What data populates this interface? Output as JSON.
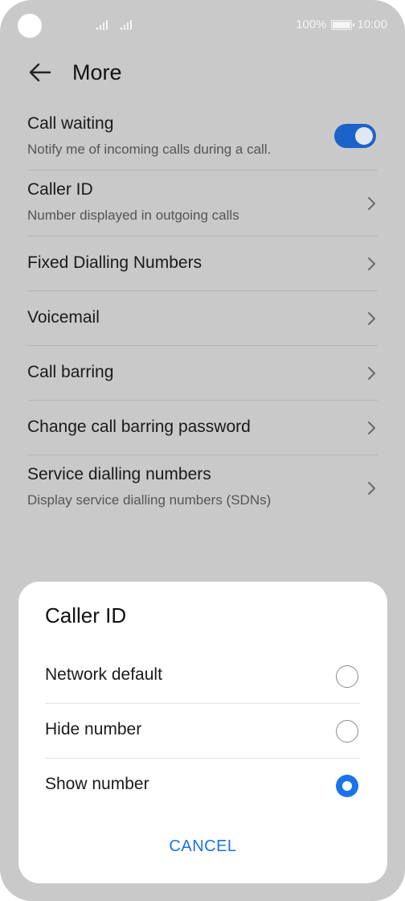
{
  "status_bar": {
    "battery_text": "100%",
    "time": "10:00"
  },
  "header": {
    "title": "More"
  },
  "settings": [
    {
      "label": "Call waiting",
      "sub": "Notify me of incoming calls during a call.",
      "control": "toggle",
      "toggle_on": true
    },
    {
      "label": "Caller ID",
      "sub": "Number displayed in outgoing calls",
      "control": "chevron"
    },
    {
      "label": "Fixed Dialling Numbers",
      "sub": "",
      "control": "chevron"
    },
    {
      "label": "Voicemail",
      "sub": "",
      "control": "chevron"
    },
    {
      "label": "Call barring",
      "sub": "",
      "control": "chevron"
    },
    {
      "label": "Change call barring password",
      "sub": "",
      "control": "chevron"
    },
    {
      "label": "Service dialling numbers",
      "sub": "Display service dialling numbers (SDNs)",
      "control": "chevron"
    }
  ],
  "dialog": {
    "title": "Caller ID",
    "options": [
      {
        "label": "Network default",
        "selected": false
      },
      {
        "label": "Hide number",
        "selected": false
      },
      {
        "label": "Show number",
        "selected": true
      }
    ],
    "cancel_label": "CANCEL"
  },
  "colors": {
    "accent": "#1a73e8",
    "toggle_on": "#1b63c9",
    "dim_background": "#c9c9c9"
  }
}
